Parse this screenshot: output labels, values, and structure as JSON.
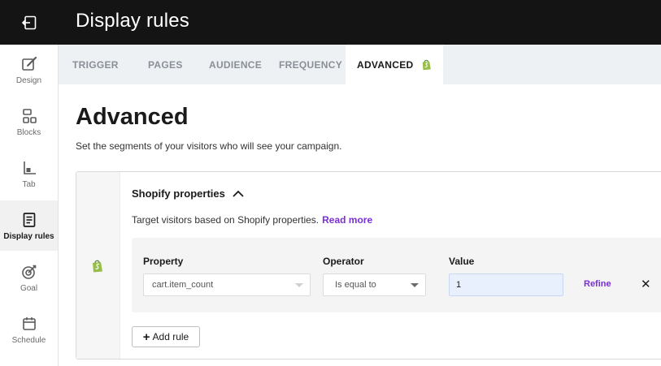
{
  "header": {
    "title": "Display rules"
  },
  "sidebar": {
    "items": [
      {
        "label": "Design",
        "icon": "design-icon"
      },
      {
        "label": "Blocks",
        "icon": "blocks-icon"
      },
      {
        "label": "Tab",
        "icon": "tab-icon"
      },
      {
        "label": "Display rules",
        "icon": "display-rules-icon",
        "active": true
      },
      {
        "label": "Goal",
        "icon": "goal-icon"
      },
      {
        "label": "Schedule",
        "icon": "schedule-icon"
      }
    ]
  },
  "tabs": [
    {
      "label": "TRIGGER"
    },
    {
      "label": "PAGES"
    },
    {
      "label": "AUDIENCE"
    },
    {
      "label": "FREQUENCY"
    },
    {
      "label": "ADVANCED",
      "active": true
    }
  ],
  "page": {
    "title": "Advanced",
    "subtitle": "Set the segments of your visitors who will see your campaign."
  },
  "section": {
    "title": "Shopify properties",
    "description": "Target visitors based on Shopify properties.",
    "read_more": "Read more",
    "rule": {
      "property_label": "Property",
      "property_value": "cart.item_count",
      "operator_label": "Operator",
      "operator_value": "Is equal to",
      "value_label": "Value",
      "value": "1",
      "refine": "Refine",
      "remove": "✕"
    },
    "add_rule": "Add rule"
  },
  "colors": {
    "header_bg": "#141414",
    "accent": "#7b2fd6",
    "shopify_green": "#95bf47",
    "tab_bar_bg": "#eef1f4"
  }
}
